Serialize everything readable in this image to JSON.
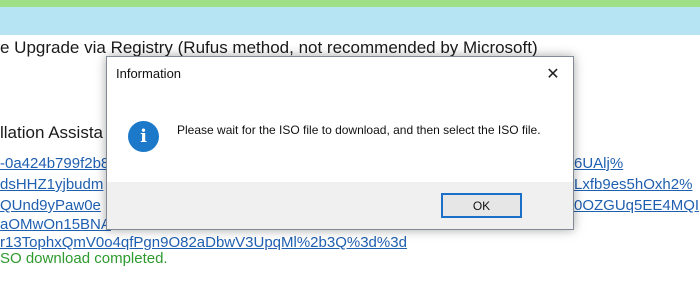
{
  "background": {
    "heading": "e Upgrade via Registry (Rufus method, not recommended by Microsoft)",
    "section_title": "llation Assista",
    "links_left": [
      "-0a424b799f2b8",
      "dsHHZ1yjbudm",
      "QUnd9yPaw0e",
      "aOMwOn15BNA",
      "r13TophxQmV0o4qfPgn9O82aDbwV3UpqMl%2b3Q%3d%3d"
    ],
    "links_right": [
      "6UAlj%",
      "Lxfb9es5hOxh2%",
      "0OZGUq5EE4MQI"
    ],
    "status": "SO download completed."
  },
  "dialog": {
    "title": "Information",
    "close_glyph": "✕",
    "icon_glyph": "i",
    "message": "Please wait for the ISO file to download, and then select the ISO file.",
    "ok_label": "OK"
  }
}
